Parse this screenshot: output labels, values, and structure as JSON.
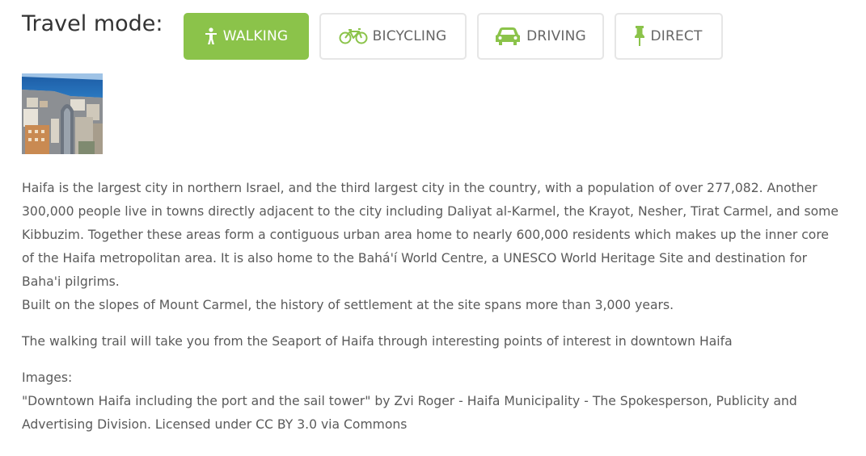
{
  "travel_mode": {
    "label": "Travel mode:",
    "active": "walking",
    "accent_color": "#8bc34a",
    "buttons": [
      {
        "id": "walking",
        "label": "WALKING",
        "icon": "walking-person-icon"
      },
      {
        "id": "bicycling",
        "label": "BICYCLING",
        "icon": "bicycle-icon"
      },
      {
        "id": "driving",
        "label": "DRIVING",
        "icon": "car-icon"
      },
      {
        "id": "direct",
        "label": "DIRECT",
        "icon": "pin-icon"
      }
    ]
  },
  "thumbnail": {
    "alt": "Downtown Haifa including the port and the sail tower"
  },
  "description": {
    "paragraph_1": "Haifa is the largest city in northern Israel, and the third largest city in the country, with a population of over 277,082. Another 300,000 people live in towns directly adjacent to the city including Daliyat al-Karmel, the Krayot, Nesher, Tirat Carmel, and some Kibbuzim. Together these areas form a contiguous urban area home to nearly 600,000 residents which makes up the inner core of the Haifa metropolitan area. It is also home to the Bahá'í World Centre, a UNESCO World Heritage Site and destination for Baha'i pilgrims.",
    "paragraph_2": "Built on the slopes of Mount Carmel, the history of settlement at the site spans more than 3,000 years.",
    "trail": "The walking trail will take you from the Seaport of Haifa through interesting points of interest in downtown Haifa",
    "images_heading": "Images:",
    "image_credit": "\"Downtown Haifa including the port and the sail tower\" by Zvi Roger - Haifa Municipality - The Spokesperson, Publicity and Advertising Division. Licensed under CC BY 3.0 via Commons"
  }
}
